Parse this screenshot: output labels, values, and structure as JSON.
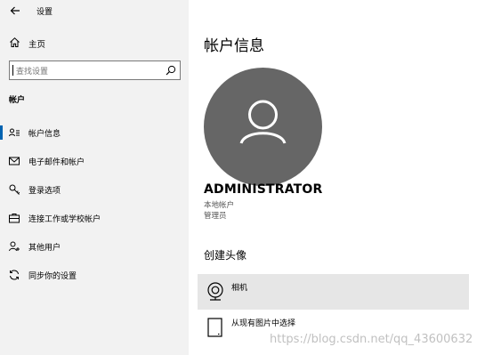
{
  "window": {
    "title": "设置"
  },
  "sidebar": {
    "home_label": "主页",
    "search_placeholder": "查找设置",
    "section_label": "帐户",
    "items": [
      {
        "label": "帐户信息",
        "icon": "person-card-icon",
        "selected": true
      },
      {
        "label": "电子邮件和帐户",
        "icon": "mail-icon",
        "selected": false
      },
      {
        "label": "登录选项",
        "icon": "key-icon",
        "selected": false
      },
      {
        "label": "连接工作或学校帐户",
        "icon": "briefcase-icon",
        "selected": false
      },
      {
        "label": "其他用户",
        "icon": "person-add-icon",
        "selected": false
      },
      {
        "label": "同步你的设置",
        "icon": "sync-icon",
        "selected": false
      }
    ]
  },
  "main": {
    "title": "帐户信息",
    "user_name": "ADMINISTRATOR",
    "account_type": "本地帐户",
    "account_role": "管理员",
    "create_avatar_title": "创建头像",
    "options": [
      {
        "label": "相机",
        "icon": "camera-icon"
      },
      {
        "label": "从现有图片中选择",
        "icon": "picture-icon"
      }
    ]
  },
  "watermark": "https://blog.csdn.net/qq_43600632",
  "colors": {
    "accent": "#0063b1",
    "sidebar_bg": "#f2f2f2",
    "avatar_bg": "#666666",
    "hover_bg": "#e6e6e6"
  }
}
